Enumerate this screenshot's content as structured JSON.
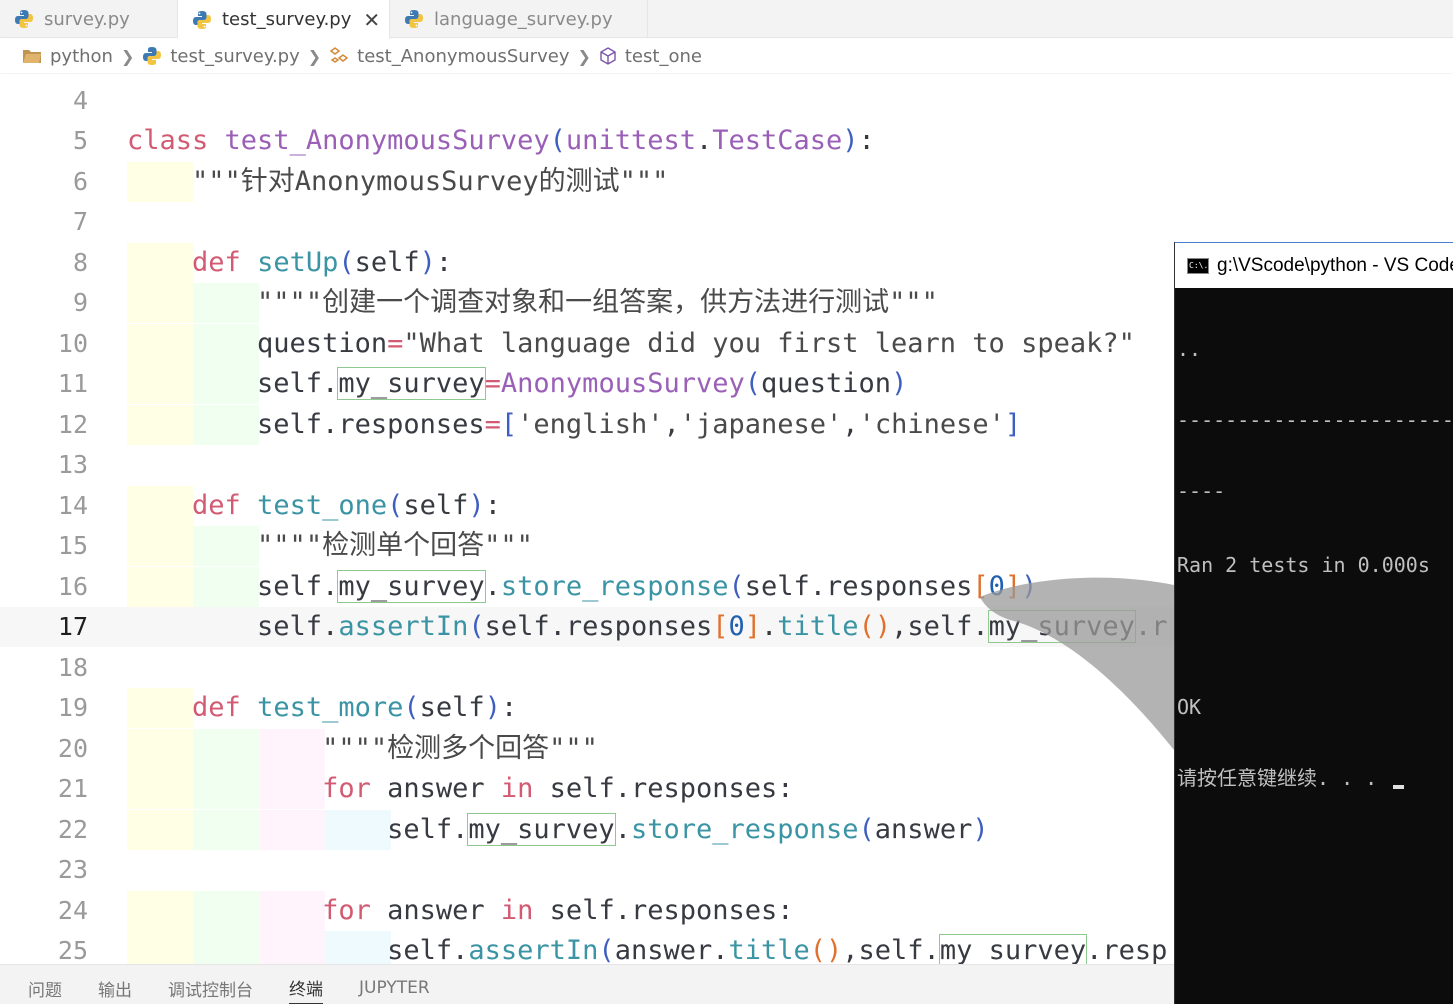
{
  "tabs": [
    {
      "label": "survey.py",
      "active": false
    },
    {
      "label": "test_survey.py",
      "active": true
    },
    {
      "label": "language_survey.py",
      "active": false
    }
  ],
  "breadcrumb": {
    "folder": "python",
    "file": "test_survey.py",
    "class": "test_AnonymousSurvey",
    "method": "test_one"
  },
  "editor": {
    "current_line": 17,
    "lines": [
      {
        "n": "4",
        "text": ""
      },
      {
        "n": "5",
        "text": "class test_AnonymousSurvey(unittest.TestCase):"
      },
      {
        "n": "6",
        "text": "    \"\"\"针对AnonymousSurvey的测试\"\"\""
      },
      {
        "n": "7",
        "text": ""
      },
      {
        "n": "8",
        "text": "    def setUp(self):"
      },
      {
        "n": "9",
        "text": "        \"\"\"\"创建一个调查对象和一组答案，供方法进行测试\"\"\""
      },
      {
        "n": "10",
        "text": "        question=\"What language did you first learn to speak?\""
      },
      {
        "n": "11",
        "text": "        self.my_survey=AnonymousSurvey(question)"
      },
      {
        "n": "12",
        "text": "        self.responses=['english','japanese','chinese']"
      },
      {
        "n": "13",
        "text": ""
      },
      {
        "n": "14",
        "text": "    def test_one(self):"
      },
      {
        "n": "15",
        "text": "        \"\"\"\"检测单个回答\"\"\""
      },
      {
        "n": "16",
        "text": "        self.my_survey.store_response(self.responses[0])"
      },
      {
        "n": "17",
        "text": "        self.assertIn(self.responses[0].title(),self.my_survey.r"
      },
      {
        "n": "18",
        "text": ""
      },
      {
        "n": "19",
        "text": "    def test_more(self):"
      },
      {
        "n": "20",
        "text": "            \"\"\"\"检测多个回答\"\"\""
      },
      {
        "n": "21",
        "text": "            for answer in self.responses:"
      },
      {
        "n": "22",
        "text": "                self.my_survey.store_response(answer)"
      },
      {
        "n": "23",
        "text": ""
      },
      {
        "n": "24",
        "text": "            for answer in self.responses:"
      },
      {
        "n": "25",
        "text": "                self.assertIn(answer.title(),self.my_survey.resp"
      }
    ]
  },
  "panel_tabs": [
    "问题",
    "输出",
    "调试控制台",
    "终端",
    "JUPYTER"
  ],
  "panel_active": "终端",
  "console": {
    "title": "g:\\VScode\\python - VS Code",
    "icon_text": "C:\\.",
    "lines": [
      "..",
      "-----------------------",
      "----",
      "Ran 2 tests in 0.000s",
      "",
      "OK",
      "请按任意键继续. . . "
    ]
  }
}
